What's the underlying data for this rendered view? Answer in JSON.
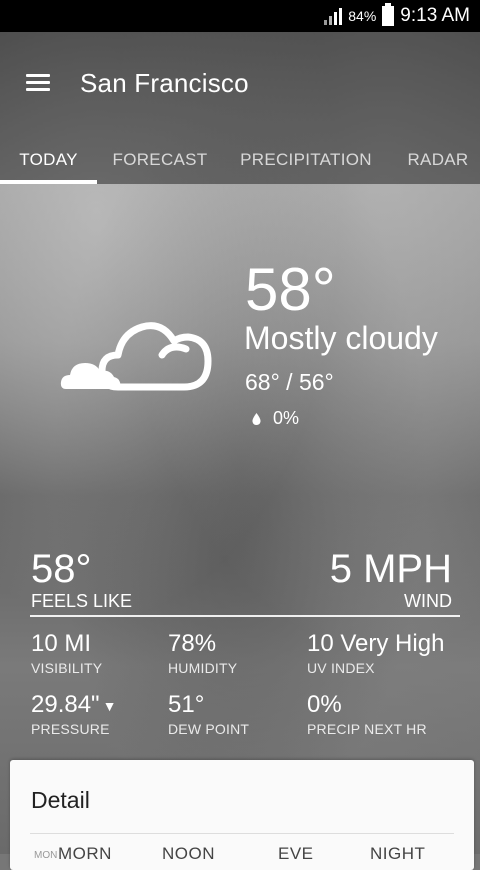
{
  "status_bar": {
    "battery_percent": "84%",
    "time": "9:13 AM",
    "signal_icon": "signal-bars-icon",
    "battery_icon": "battery-icon"
  },
  "app_bar": {
    "menu_icon": "hamburger-menu-icon",
    "city": "San Francisco",
    "tabs": [
      {
        "label": "TODAY",
        "active": true
      },
      {
        "label": "FORECAST",
        "active": false
      },
      {
        "label": "PRECIPITATION",
        "active": false
      },
      {
        "label": "RADAR",
        "active": false
      }
    ]
  },
  "current": {
    "icon": "mostly-cloudy-icon",
    "temperature": "58°",
    "condition": "Mostly cloudy",
    "hi_lo": "68° / 56°",
    "precip_icon": "raindrop-icon",
    "precip_chance": "0%"
  },
  "stats": {
    "feels_like": {
      "value": "58°",
      "label": "FEELS LIKE"
    },
    "wind": {
      "value": "5 MPH",
      "label": "WIND"
    },
    "visibility": {
      "value": "10 MI",
      "label": "VISIBILITY"
    },
    "humidity": {
      "value": "78%",
      "label": "HUMIDITY"
    },
    "uv_index": {
      "value": "10 Very High",
      "label": "UV INDEX"
    },
    "pressure": {
      "value": "29.84\"",
      "trend_icon": "down-triangle-icon",
      "label": "PRESSURE"
    },
    "dew_point": {
      "value": "51°",
      "label": "DEW POINT"
    },
    "precip_next_hr": {
      "value": "0%",
      "label": "PRECIP NEXT HR"
    }
  },
  "detail": {
    "title": "Detail",
    "day_label": "MON",
    "columns": [
      "MORN",
      "NOON",
      "EVE",
      "NIGHT"
    ]
  },
  "colors": {
    "status_bar": "#000000",
    "text": "#ffffff",
    "card": "#fafafa",
    "card_text": "#222222"
  }
}
